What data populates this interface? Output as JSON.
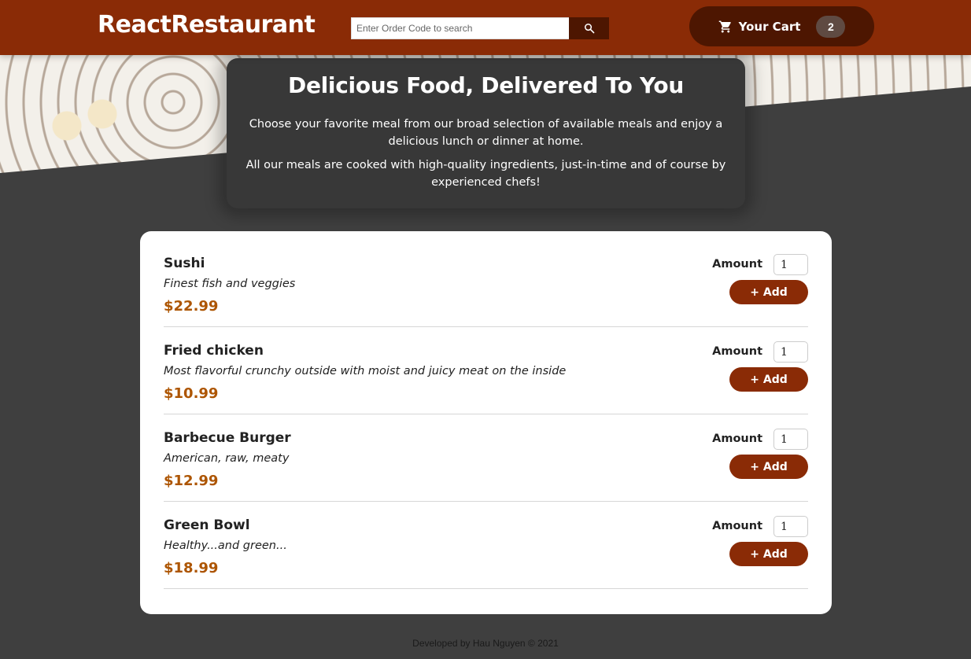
{
  "header": {
    "brand": "ReactRestaurant",
    "search_placeholder": "Enter Order Code to search",
    "search_icon": "search-icon",
    "cart_icon": "shopping-cart-icon",
    "cart_label": "Your Cart",
    "cart_count": "2",
    "background_color": "#8a2b06",
    "accent_dark": "#4d1601"
  },
  "summary": {
    "title": "Delicious Food, Delivered To You",
    "paragraph1": "Choose your favorite meal from our broad selection of available meals and enjoy a delicious lunch or dinner at home.",
    "paragraph2": "All our meals are cooked with high-quality ingredients, just-in-time and of course by experienced chefs!"
  },
  "meals": [
    {
      "name": "Sushi",
      "description": "Finest fish and veggies",
      "price": "$22.99",
      "amount_label": "Amount",
      "amount": "1",
      "add_label": "+ Add"
    },
    {
      "name": "Fried chicken",
      "description": "Most flavorful crunchy outside with moist and juicy meat on the inside",
      "price": "$10.99",
      "amount_label": "Amount",
      "amount": "1",
      "add_label": "+ Add"
    },
    {
      "name": "Barbecue Burger",
      "description": "American, raw, meaty",
      "price": "$12.99",
      "amount_label": "Amount",
      "amount": "1",
      "add_label": "+ Add"
    },
    {
      "name": "Green Bowl",
      "description": "Healthy...and green...",
      "price": "$18.99",
      "amount_label": "Amount",
      "amount": "1",
      "add_label": "+ Add"
    }
  ],
  "footer": {
    "text": "Developed by Hau Nguyen © 2021"
  },
  "colors": {
    "price": "#ad5502",
    "page_background": "#3f3f3f",
    "summary_background": "#383838"
  }
}
